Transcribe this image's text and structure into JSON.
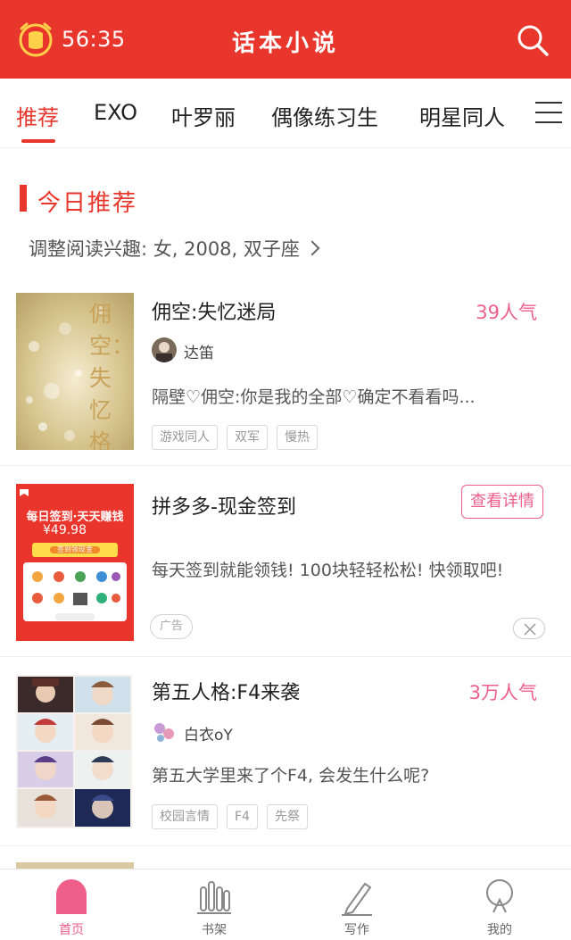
{
  "status": {
    "time": "56:35"
  },
  "header": {
    "title": "话本小说"
  },
  "tabs": [
    {
      "label": "推荐",
      "active": true
    },
    {
      "label": "EXO"
    },
    {
      "label": "叶罗丽"
    },
    {
      "label": "偶像练习生"
    },
    {
      "label": "明星同人"
    }
  ],
  "section": {
    "title": "今日推荐",
    "interest": "调整阅读兴趣: 女, 2008, 双子座"
  },
  "books": [
    {
      "title": "佣空:失忆迷局",
      "popularity": "39人气",
      "author": "达笛",
      "desc": "隔壁♡佣空:你是我的全部♡确定不看看吗...",
      "tags": [
        "游戏同人",
        "双军",
        "慢热"
      ],
      "cover_text": "佣空：失忆格局"
    },
    {
      "title": "第五人格:F4来袭",
      "popularity": "3万人气",
      "author": "白衣oY",
      "desc": "第五大学里来了个F4, 会发生什么呢?",
      "tags": [
        "校园言情",
        "F4",
        "先祭"
      ]
    }
  ],
  "ad": {
    "title": "拼多多-现金签到",
    "button": "查看详情",
    "desc": "每天签到就能领钱! 100块轻轻松松! 快领取吧!",
    "badge": "广告",
    "banner_title": "每日签到·天天赚钱",
    "banner_amount": "¥49.98",
    "banner_cta": "签到领现金"
  },
  "bottom_nav": [
    {
      "label": "首页",
      "active": true
    },
    {
      "label": "书架"
    },
    {
      "label": "写作"
    },
    {
      "label": "我的"
    }
  ],
  "colors": {
    "brand_red": "#e8362c",
    "accent_pink": "#ef5f8b"
  }
}
